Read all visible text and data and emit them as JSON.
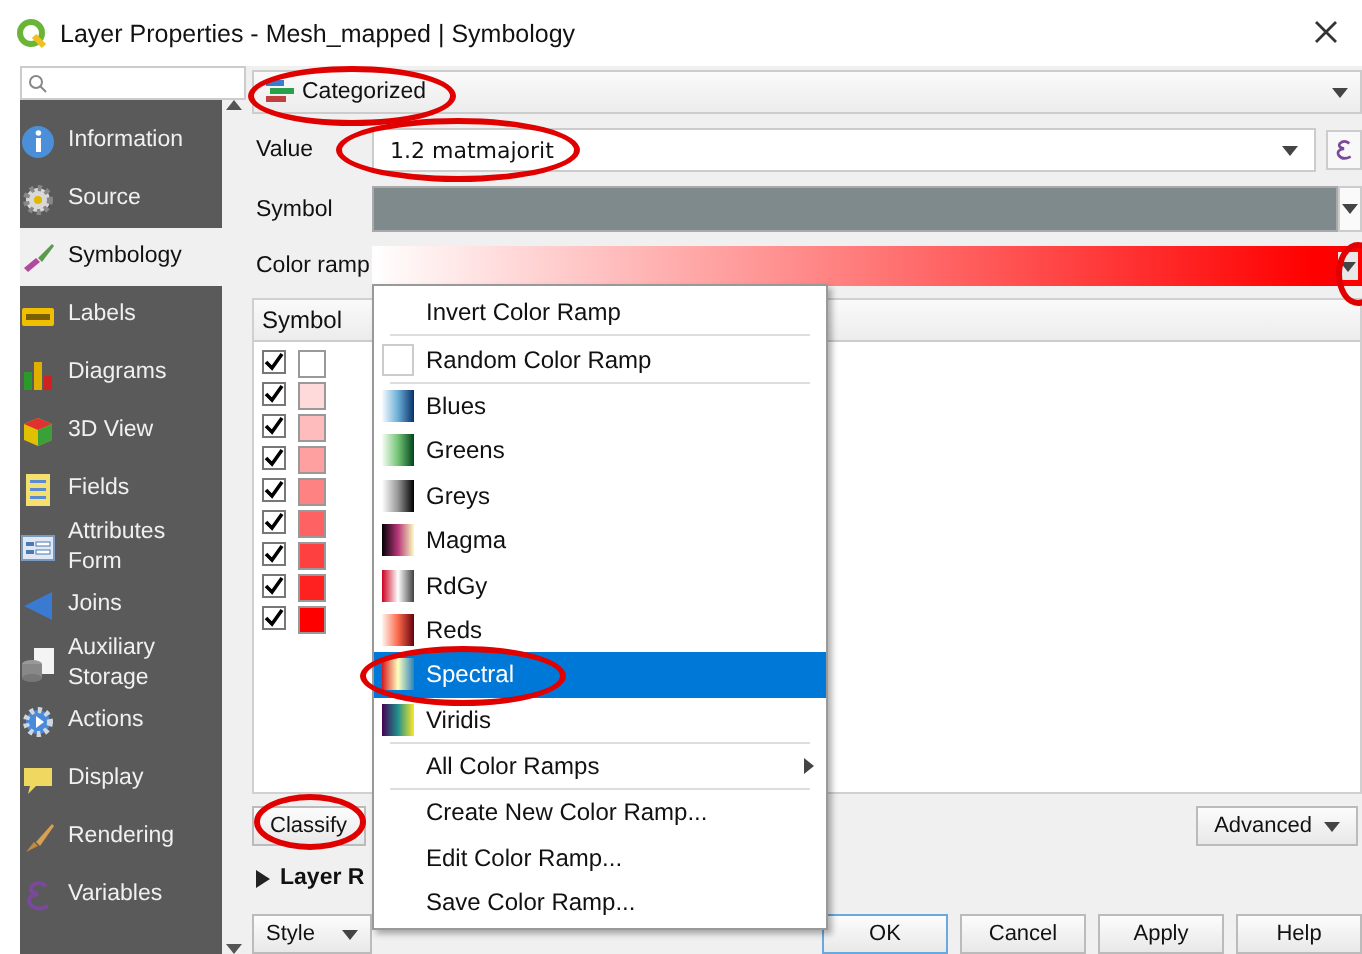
{
  "window": {
    "title": "Layer Properties - Mesh_mapped | Symbology"
  },
  "sidebar": {
    "items": [
      {
        "label": "Information",
        "selected": false
      },
      {
        "label": "Source",
        "selected": false
      },
      {
        "label": "Symbology",
        "selected": true
      },
      {
        "label": "Labels",
        "selected": false
      },
      {
        "label": "Diagrams",
        "selected": false
      },
      {
        "label": "3D View",
        "selected": false
      },
      {
        "label": "Fields",
        "selected": false
      },
      {
        "label": "Attributes Form",
        "selected": false
      },
      {
        "label": "Joins",
        "selected": false
      },
      {
        "label": "Auxiliary Storage",
        "selected": false
      },
      {
        "label": "Actions",
        "selected": false
      },
      {
        "label": "Display",
        "selected": false
      },
      {
        "label": "Rendering",
        "selected": false
      },
      {
        "label": "Variables",
        "selected": false
      }
    ]
  },
  "renderer": {
    "value": "Categorized",
    "circled": true
  },
  "value_row": {
    "label": "Value",
    "value": "1.2 matmajorit",
    "circled": true
  },
  "symbol_row": {
    "label": "Symbol",
    "color": "#7f8a8d"
  },
  "color_ramp_row": {
    "label": "Color ramp",
    "circled": true
  },
  "table": {
    "columns": [
      "Symbol"
    ],
    "rows": [
      {
        "checked": true,
        "color": "#ffffff"
      },
      {
        "checked": true,
        "color": "#ffdada"
      },
      {
        "checked": true,
        "color": "#ffbcbc"
      },
      {
        "checked": true,
        "color": "#ffa0a0"
      },
      {
        "checked": true,
        "color": "#ff8282"
      },
      {
        "checked": true,
        "color": "#ff6262"
      },
      {
        "checked": true,
        "color": "#ff4040"
      },
      {
        "checked": true,
        "color": "#ff2020"
      },
      {
        "checked": true,
        "color": "#ff0000"
      }
    ]
  },
  "classify_button": {
    "label": "Classify",
    "circled": true
  },
  "advanced_button": {
    "label": "Advanced"
  },
  "layer_rendering": {
    "label": "Layer R",
    "expanded": false
  },
  "footer": {
    "style_button": "Style",
    "buttons": [
      "OK",
      "Cancel",
      "Apply",
      "Help"
    ]
  },
  "menu": {
    "items": [
      {
        "kind": "action",
        "label": "Invert Color Ramp",
        "selected": false,
        "circled": false
      },
      {
        "kind": "separator"
      },
      {
        "kind": "random",
        "label": "Random Color Ramp",
        "selected": false,
        "circled": false
      },
      {
        "kind": "separator"
      },
      {
        "kind": "ramp",
        "label": "Blues",
        "selected": false,
        "circled": false
      },
      {
        "kind": "ramp",
        "label": "Greens",
        "selected": false,
        "circled": false
      },
      {
        "kind": "ramp",
        "label": "Greys",
        "selected": false,
        "circled": false
      },
      {
        "kind": "ramp",
        "label": "Magma",
        "selected": false,
        "circled": false
      },
      {
        "kind": "ramp",
        "label": "RdGy",
        "selected": false,
        "circled": false
      },
      {
        "kind": "ramp",
        "label": "Reds",
        "selected": false,
        "circled": false
      },
      {
        "kind": "ramp",
        "label": "Spectral",
        "selected": true,
        "circled": true
      },
      {
        "kind": "ramp",
        "label": "Viridis",
        "selected": false,
        "circled": false
      },
      {
        "kind": "separator"
      },
      {
        "kind": "submenu",
        "label": "All Color Ramps",
        "selected": false,
        "circled": false
      },
      {
        "kind": "separator"
      },
      {
        "kind": "action",
        "label": "Create New Color Ramp...",
        "selected": false,
        "circled": false
      },
      {
        "kind": "action",
        "label": "Edit Color Ramp...",
        "selected": false,
        "circled": false
      },
      {
        "kind": "action",
        "label": "Save Color Ramp...",
        "selected": false,
        "circled": false
      }
    ]
  }
}
